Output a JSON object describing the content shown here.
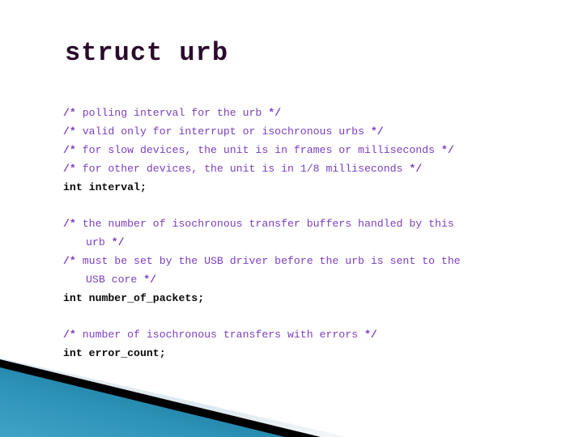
{
  "slide": {
    "title": "struct urb",
    "colors": {
      "title": "#2B0A2B",
      "comment": "#7B3FBF",
      "declaration": "#0A0A0A",
      "background": "#FFFFFF",
      "footer_teal_dark": "#15708F",
      "footer_teal_light": "#55AFD0",
      "footer_black": "#000000",
      "footer_pale_blue": "#DCE7ED"
    },
    "blocks": [
      {
        "id": "interval-block",
        "comments": [
          {
            "open": "/*",
            "text": " polling interval for the urb ",
            "close": "*/",
            "indented": false
          },
          {
            "open": "/*",
            "text": " valid only for interrupt or isochronous urbs ",
            "close": "*/",
            "indented": false
          },
          {
            "open": "/*",
            "text": " for slow devices, the unit is in frames or milliseconds ",
            "close": "*/",
            "indented": false
          },
          {
            "open": "/*",
            "text": " for other devices, the unit is in 1/8 milliseconds ",
            "close": "*/",
            "indented": false
          }
        ],
        "declaration": "int interval;"
      },
      {
        "id": "number-of-packets-block",
        "comments": [
          {
            "open": "/*",
            "text": " the number of isochronous transfer buffers handled by this",
            "close": "",
            "indented": false
          },
          {
            "open": "",
            "text": "urb ",
            "close": "*/",
            "indented": true
          },
          {
            "open": "/*",
            "text": " must be set by the USB driver before the urb is sent to the",
            "close": "",
            "indented": false
          },
          {
            "open": "",
            "text": "USB core ",
            "close": "*/",
            "indented": true
          }
        ],
        "declaration": "int number_of_packets;"
      },
      {
        "id": "error-count-block",
        "comments": [
          {
            "open": "/*",
            "text": " number of isochronous transfers with errors ",
            "close": "*/",
            "indented": false
          }
        ],
        "declaration": "int error_count;"
      }
    ]
  }
}
